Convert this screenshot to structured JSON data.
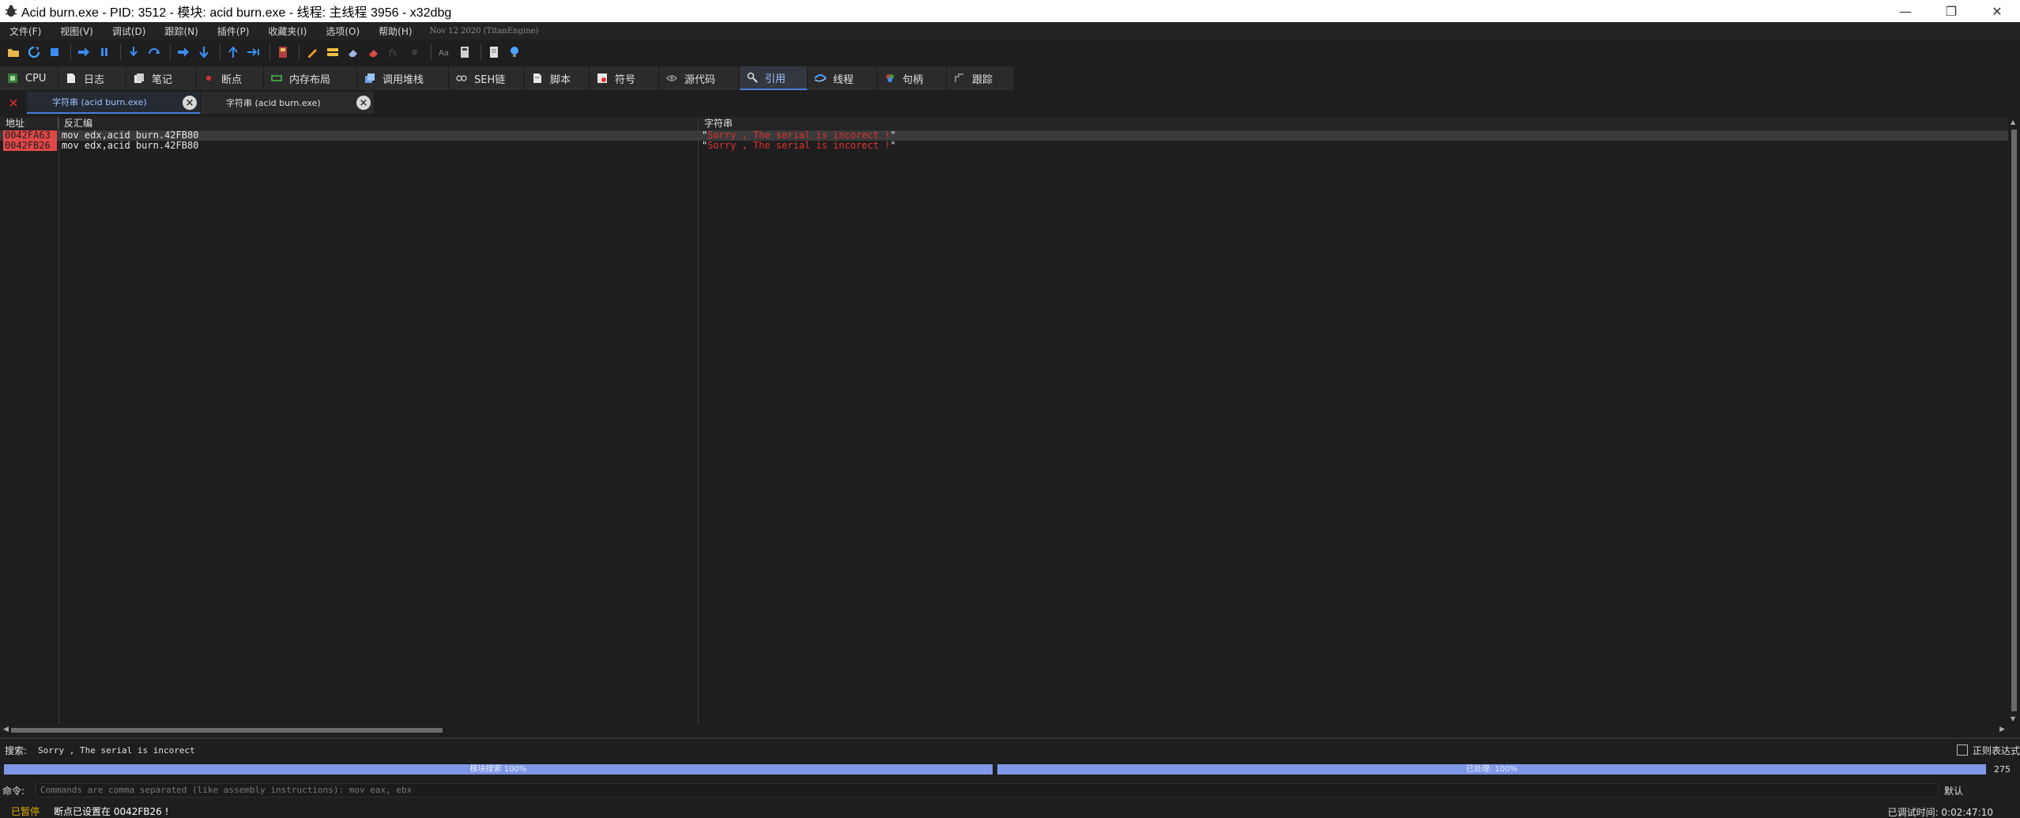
{
  "window": {
    "title": "Acid burn.exe - PID: 3512 - 模块: acid burn.exe - 线程: 主线程 3956 - x32dbg",
    "controls": {
      "minimize": "—",
      "restore": "❐",
      "close": "✕"
    }
  },
  "menu": {
    "items": [
      "文件(F)",
      "视图(V)",
      "调试(D)",
      "跟踪(N)",
      "插件(P)",
      "收藏夹(I)",
      "选项(O)",
      "帮助(H)"
    ],
    "build_info": "Nov 12 2020 (TitanEngine)"
  },
  "toolbar": {
    "icons": [
      "open-icon",
      "restart-icon",
      "stop-icon",
      "run-icon",
      "pause-icon",
      "step-into-icon",
      "step-over-icon",
      "trace-into-icon",
      "trace-over-icon",
      "execute-till-return-icon",
      "run-to-user-code-icon",
      "scylla-icon",
      "patch-icon",
      "highlight-icon",
      "erase-icon",
      "eraser-icon",
      "function-icon",
      "hash-icon",
      "font-icon",
      "calculator-icon",
      "notes-icon",
      "bulb-icon"
    ]
  },
  "tabs": [
    {
      "label": "CPU",
      "icon": "cpu-icon"
    },
    {
      "label": "日志",
      "icon": "log-icon"
    },
    {
      "label": "笔记",
      "icon": "notes-icon"
    },
    {
      "label": "断点",
      "icon": "breakpoint-icon"
    },
    {
      "label": "内存布局",
      "icon": "memory-map-icon"
    },
    {
      "label": "调用堆栈",
      "icon": "call-stack-icon"
    },
    {
      "label": "SEH链",
      "icon": "seh-icon"
    },
    {
      "label": "脚本",
      "icon": "script-icon"
    },
    {
      "label": "符号",
      "icon": "symbols-icon"
    },
    {
      "label": "源代码",
      "icon": "source-icon"
    },
    {
      "label": "引用",
      "icon": "references-icon",
      "active": true
    },
    {
      "label": "线程",
      "icon": "threads-icon"
    },
    {
      "label": "句柄",
      "icon": "handles-icon"
    },
    {
      "label": "跟踪",
      "icon": "trace-icon"
    }
  ],
  "subtabs": [
    {
      "label": "字符串 (acid burn.exe)",
      "active": true
    },
    {
      "label": "字符串 (acid burn.exe)",
      "active": false
    }
  ],
  "table": {
    "headers": {
      "address": "地址",
      "disassembly": "反汇编",
      "string": "字符串"
    },
    "rows": [
      {
        "address": "0042FA63",
        "disassembly": "mov edx,acid burn.42FB80",
        "string": "Sorry , The serial is incorect !"
      },
      {
        "address": "0042FB26",
        "disassembly": "mov edx,acid burn.42FB80",
        "string": "Sorry , The serial is incorect !"
      }
    ]
  },
  "search": {
    "label": "搜索:",
    "value": "Sorry , The serial is incorect",
    "regex_label": "正则表达式"
  },
  "progress": {
    "module_label": "模块搜索 100%",
    "module_value": 1.0,
    "total_label": "已处理: 100%",
    "total_value": 1.0,
    "count": "275"
  },
  "command": {
    "label": "命令:",
    "placeholder": "Commands are comma separated (like assembly instructions): mov eax, ebx",
    "default": "默认"
  },
  "status": {
    "state": "已暂停",
    "message": "断点已设置在 0042FB26 !",
    "time": "已调试时间: 0:02:47:10"
  },
  "colors": {
    "accent": "#4a7dd8",
    "address_bg": "#e04848",
    "string_text": "#e03030",
    "progress": "#7f97e6",
    "paused": "#e0b000"
  }
}
